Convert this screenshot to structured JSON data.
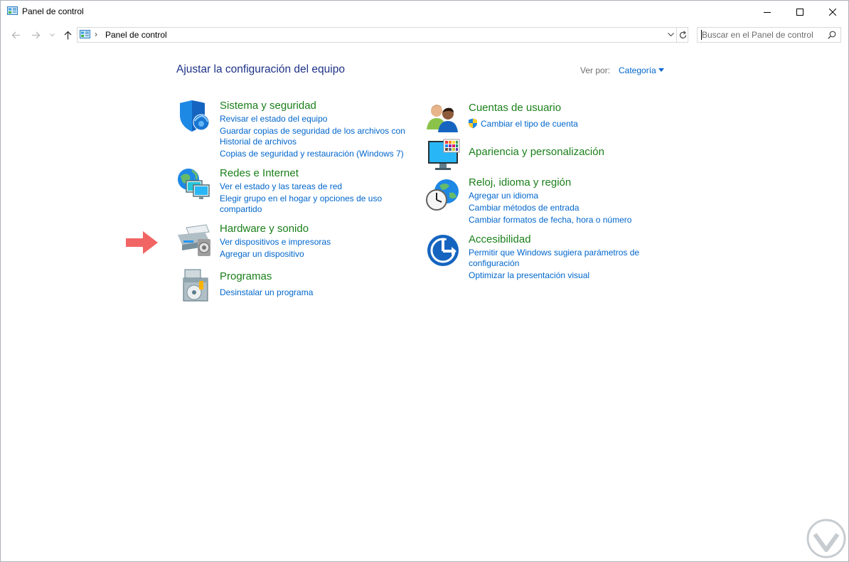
{
  "window": {
    "title": "Panel de control",
    "minimize_icon": "minimize-icon",
    "maximize_icon": "maximize-icon",
    "close_icon": "close-icon"
  },
  "nav": {
    "back_icon": "back-arrow-icon",
    "forward_icon": "forward-arrow-icon",
    "recent_icon": "chevron-down-icon",
    "up_icon": "up-arrow-icon",
    "address_path": "Panel de control",
    "address_separator": "›",
    "search_placeholder": "Buscar en el Panel de control"
  },
  "header": {
    "title": "Ajustar la configuración del equipo",
    "view_by_label": "Ver por:",
    "view_by_value": "Categoría"
  },
  "categories_left": [
    {
      "title": "Sistema y seguridad",
      "icon": "shield-icon",
      "links": [
        "Revisar el estado del equipo",
        "Guardar copias de seguridad de los archivos con",
        "Historial de archivos",
        "Copias de seguridad y restauración (Windows 7)"
      ]
    },
    {
      "title": "Redes e Internet",
      "icon": "network-globe-icon",
      "links": [
        "Ver el estado y las tareas de red",
        "Elegir grupo en el hogar y opciones de uso",
        "compartido"
      ]
    },
    {
      "title": "Hardware y sonido",
      "icon": "printer-speaker-icon",
      "links": [
        "Ver dispositivos e impresoras",
        "Agregar un dispositivo"
      ]
    },
    {
      "title": "Programas",
      "icon": "programs-disc-icon",
      "links": [
        "Desinstalar un programa"
      ]
    }
  ],
  "categories_right": [
    {
      "title": "Cuentas de usuario",
      "icon": "users-icon",
      "links": [
        "Cambiar el tipo de cuenta"
      ],
      "link_icon": "uac-shield-icon"
    },
    {
      "title": "Apariencia y personalización",
      "icon": "monitor-palette-icon",
      "links": []
    },
    {
      "title": "Reloj, idioma y región",
      "icon": "clock-globe-icon",
      "links": [
        "Agregar un idioma",
        "Cambiar métodos de entrada",
        "Cambiar formatos de fecha, hora o número"
      ]
    },
    {
      "title": "Accesibilidad",
      "icon": "accessibility-icon",
      "links": [
        "Permitir que Windows sugiera parámetros de",
        "configuración",
        "Optimizar la presentación visual"
      ]
    }
  ],
  "annotation": {
    "icon": "pointer-arrow-icon",
    "color": "#f26565"
  },
  "colors": {
    "category_title": "#1a7f1a",
    "link": "#0066cc",
    "page_title": "#1e3287"
  }
}
